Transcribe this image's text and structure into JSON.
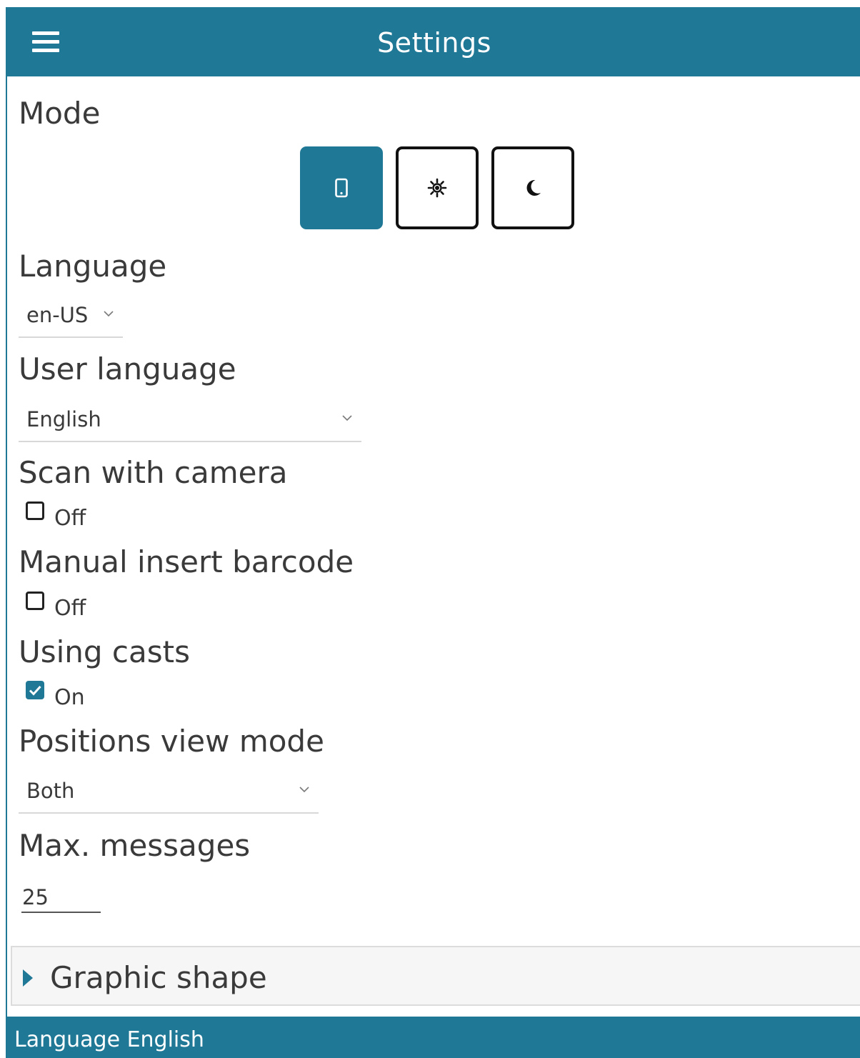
{
  "header": {
    "title": "Settings",
    "menu_icon": "hamburger-menu-icon"
  },
  "mode": {
    "label": "Mode",
    "options": [
      {
        "icon": "phone-icon",
        "selected": true
      },
      {
        "icon": "sun-icon",
        "selected": false
      },
      {
        "icon": "moon-icon",
        "selected": false
      }
    ]
  },
  "language": {
    "label": "Language",
    "value": "en-US"
  },
  "user_language": {
    "label": "User language",
    "value": "English"
  },
  "scan_with_camera": {
    "label": "Scan with camera",
    "checked": false,
    "state_text": "Off"
  },
  "manual_insert_barcode": {
    "label": "Manual insert barcode",
    "checked": false,
    "state_text": "Off"
  },
  "using_casts": {
    "label": "Using casts",
    "checked": true,
    "state_text": "On"
  },
  "positions_view_mode": {
    "label": "Positions view mode",
    "value": "Both"
  },
  "max_messages": {
    "label": "Max. messages",
    "value": "25"
  },
  "graphic_shape": {
    "label": "Graphic shape",
    "expanded": false
  },
  "status_bar": {
    "text": "Language English"
  },
  "colors": {
    "accent": "#1f7896",
    "text": "#3a3a3a",
    "background": "#ffffff"
  }
}
